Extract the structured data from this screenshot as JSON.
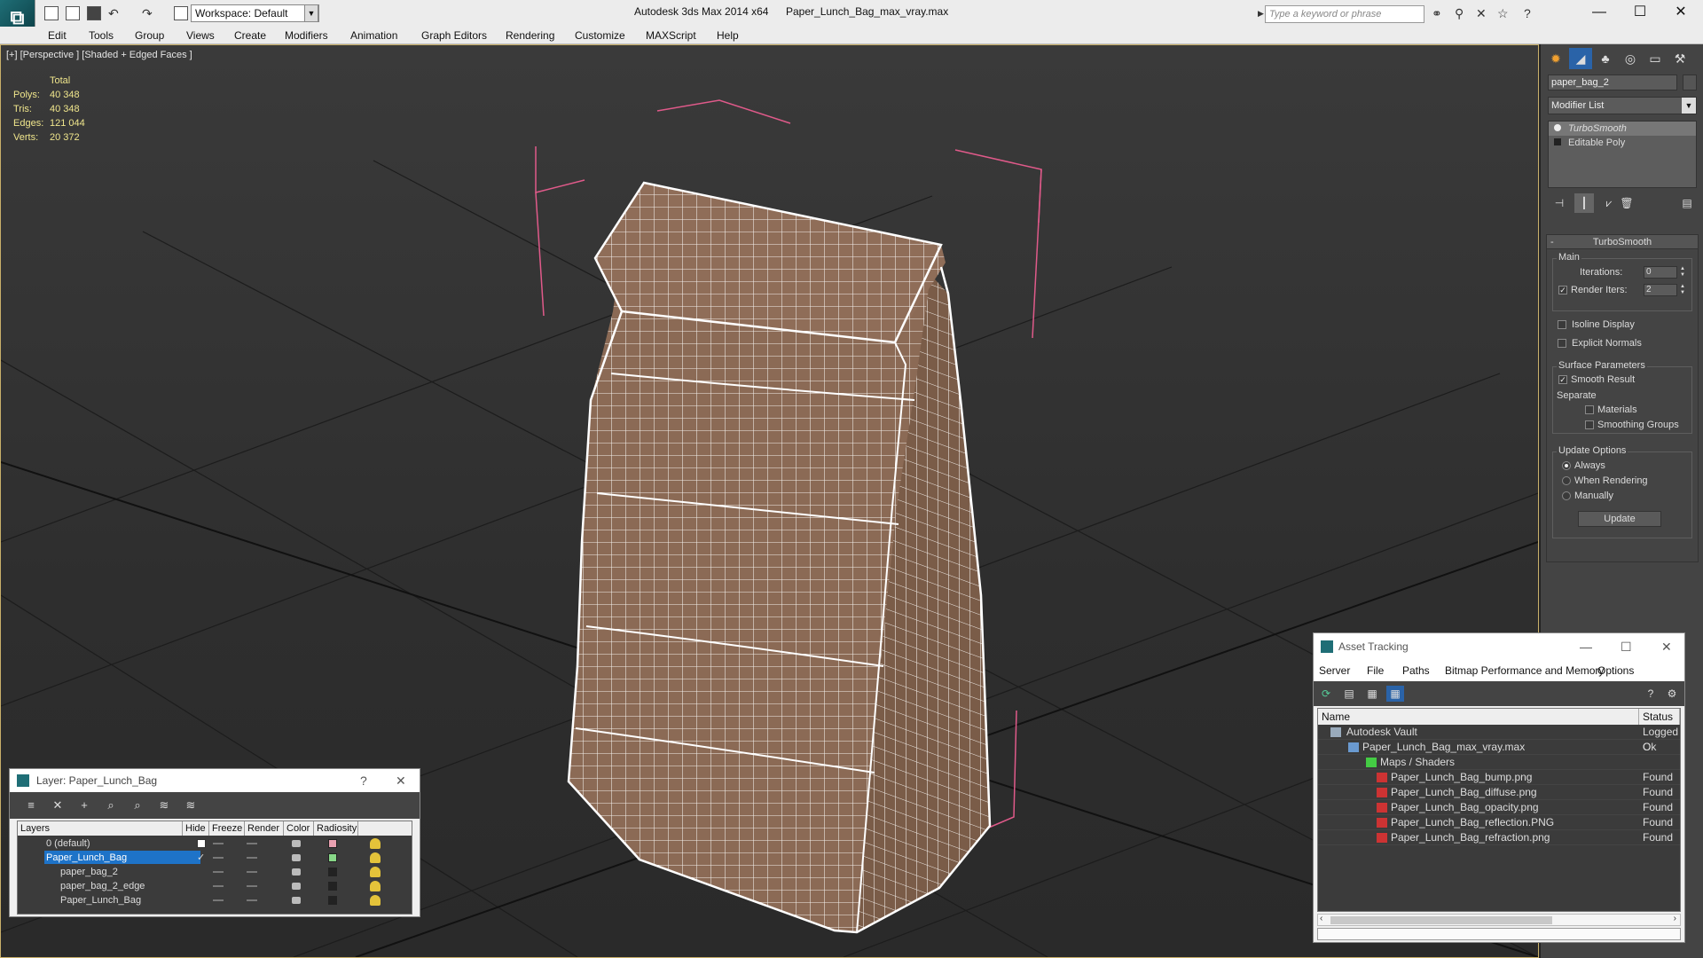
{
  "titlebar": {
    "workspace": "Workspace: Default",
    "app_title": "Autodesk 3ds Max  2014 x64",
    "file_title": "Paper_Lunch_Bag_max_vray.max",
    "search_placeholder": "Type a keyword or phrase",
    "minimize": "—",
    "maximize": "☐",
    "close": "✕"
  },
  "menu": [
    "Edit",
    "Tools",
    "Group",
    "Views",
    "Create",
    "Modifiers",
    "Animation",
    "Graph Editors",
    "Rendering",
    "Customize",
    "MAXScript",
    "Help"
  ],
  "viewport": {
    "label": "[+] [Perspective ] [Shaded + Edged Faces ]",
    "stats": {
      "header": "Total",
      "rows": [
        {
          "label": "Polys:",
          "value": "40 348"
        },
        {
          "label": "Tris:",
          "value": "40 348"
        },
        {
          "label": "Edges:",
          "value": "121 044"
        },
        {
          "label": "Verts:",
          "value": "20 372"
        }
      ]
    }
  },
  "command_panel": {
    "object_name": "paper_bag_2",
    "modifier_list": "Modifier List",
    "stack": [
      "TurboSmooth",
      "Editable Poly"
    ],
    "rollout_title": "TurboSmooth",
    "main_group": "Main",
    "iterations_label": "Iterations:",
    "iterations_value": "0",
    "render_iters_label": "Render Iters:",
    "render_iters_value": "2",
    "isoline_display": "Isoline Display",
    "explicit_normals": "Explicit Normals",
    "surface_group": "Surface Parameters",
    "smooth_result": "Smooth Result",
    "separate": "Separate",
    "materials": "Materials",
    "smoothing_groups": "Smoothing Groups",
    "update_group": "Update Options",
    "always": "Always",
    "when_rendering": "When Rendering",
    "manually": "Manually",
    "update_button": "Update"
  },
  "layer_dialog": {
    "title": "Layer: Paper_Lunch_Bag",
    "help": "?",
    "close": "✕",
    "columns": [
      "Layers",
      "Hide",
      "Freeze",
      "Render",
      "Color",
      "Radiosity"
    ],
    "rows": [
      {
        "name": "0 (default)",
        "color": "#e8a0b0"
      },
      {
        "name": "Paper_Lunch_Bag",
        "color": "#88d888"
      },
      {
        "name": "paper_bag_2",
        "color": "#222222"
      },
      {
        "name": "paper_bag_2_edge",
        "color": "#222222"
      },
      {
        "name": "Paper_Lunch_Bag",
        "color": "#222222"
      }
    ]
  },
  "asset_dialog": {
    "title": "Asset Tracking",
    "minimize": "—",
    "maximize": "☐",
    "close": "✕",
    "menu": [
      "Server",
      "File",
      "Paths",
      "Bitmap Performance and Memory",
      "Options"
    ],
    "columns": [
      "Name",
      "Status"
    ],
    "rows": [
      {
        "name": "Autodesk Vault",
        "status": "Logged O"
      },
      {
        "name": "Paper_Lunch_Bag_max_vray.max",
        "status": "Ok"
      },
      {
        "name": "Maps / Shaders",
        "status": ""
      },
      {
        "name": "Paper_Lunch_Bag_bump.png",
        "status": "Found"
      },
      {
        "name": "Paper_Lunch_Bag_diffuse.png",
        "status": "Found"
      },
      {
        "name": "Paper_Lunch_Bag_opacity.png",
        "status": "Found"
      },
      {
        "name": "Paper_Lunch_Bag_reflection.PNG",
        "status": "Found"
      },
      {
        "name": "Paper_Lunch_Bag_refraction.png",
        "status": "Found"
      }
    ]
  },
  "colors": {
    "accent": "#c9b06a",
    "selection": "#1e73c8",
    "stats_text": "#f0e68c",
    "bag": "#8b6a55",
    "wire": "#ffffff",
    "bbox": "#e05a8a"
  }
}
